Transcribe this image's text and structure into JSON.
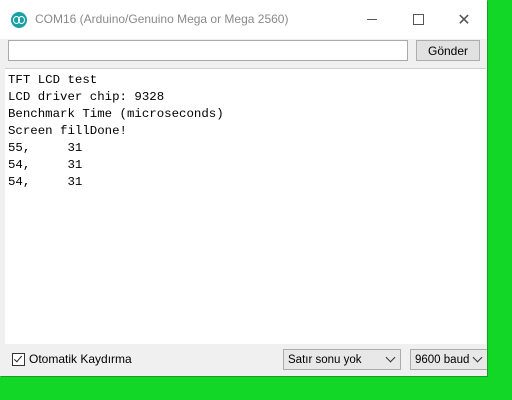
{
  "window": {
    "title": "COM16 (Arduino/Genuino Mega or Mega 2560)",
    "app_icon": "arduino-icon",
    "controls": {
      "minimize_icon": "minimize-icon",
      "maximize_icon": "maximize-icon",
      "close_icon": "close-icon",
      "close_glyph": "✕"
    }
  },
  "send": {
    "input_value": "",
    "button_label": "Gönder"
  },
  "output": {
    "lines": [
      "TFT LCD test",
      "LCD driver chip: 9328",
      "Benchmark Time (microseconds)",
      "Screen fillDone!",
      "55,     31",
      "54,     31",
      "54,     31"
    ]
  },
  "status": {
    "autoscroll_label": "Otomatik Kaydırma",
    "autoscroll_checked": true,
    "line_ending": "Satır sonu yok",
    "baud_rate": "9600 baud"
  },
  "colors": {
    "desktop_background": "#12d726",
    "window_background": "#f0f0f0",
    "app_icon": "#17a1a5"
  }
}
